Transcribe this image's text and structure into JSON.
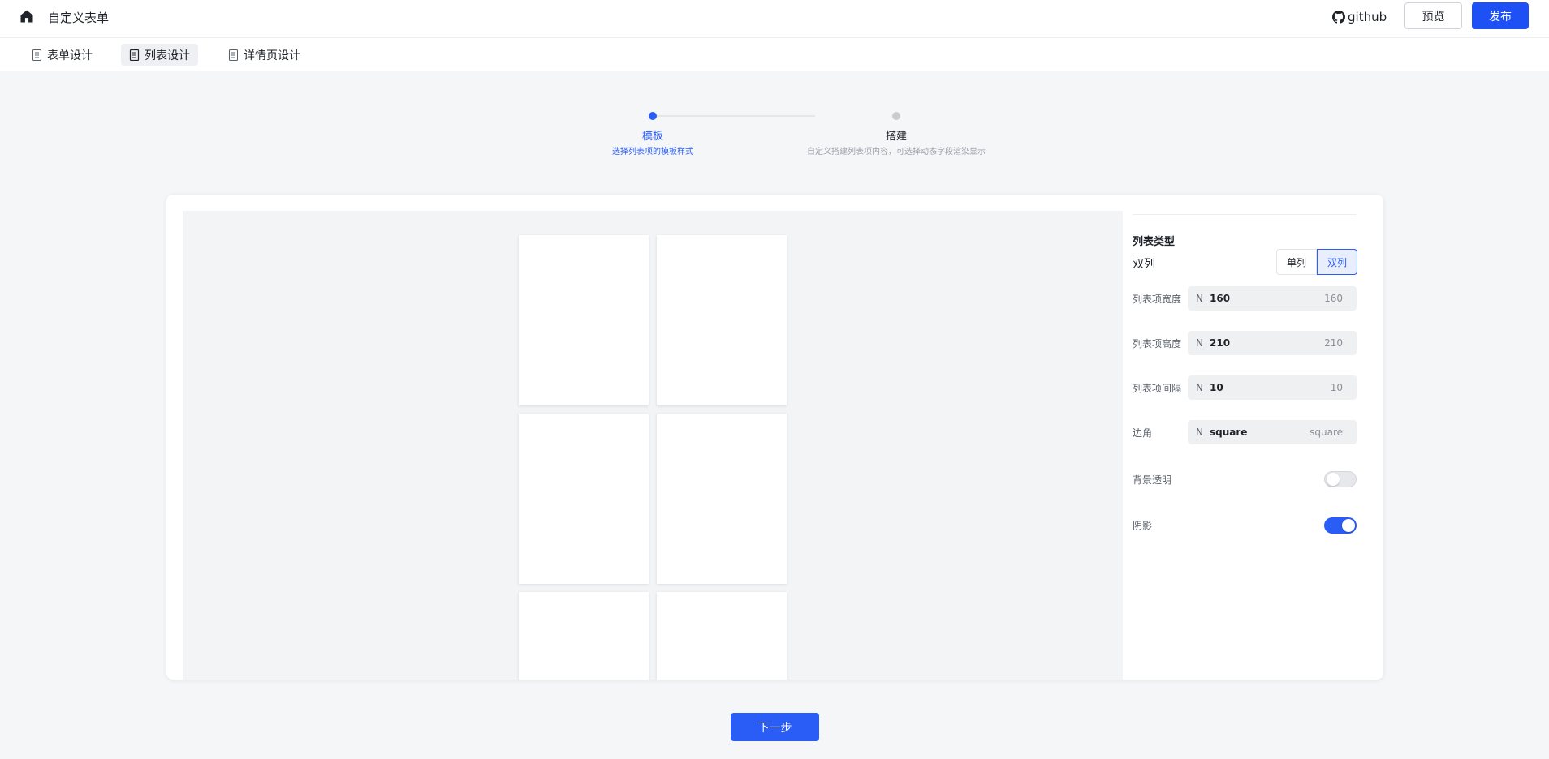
{
  "header": {
    "app_title": "自定义表单",
    "github_label": "github",
    "preview_label": "预览",
    "publish_label": "发布"
  },
  "tabs": [
    {
      "label": "表单设计",
      "active": false
    },
    {
      "label": "列表设计",
      "active": true
    },
    {
      "label": "详情页设计",
      "active": false
    }
  ],
  "steps": [
    {
      "title": "模板",
      "desc": "选择列表项的模板样式",
      "status": "current"
    },
    {
      "title": "搭建",
      "desc": "自定义搭建列表项内容，可选择动态字段渲染显示",
      "status": "wait"
    }
  ],
  "panel": {
    "section_title": "列表类型",
    "type_value": "双列",
    "options": [
      "单列",
      "双列"
    ],
    "selected_option": "双列",
    "width": {
      "label": "列表项宽度",
      "prefix": "N",
      "value": "160",
      "hint": "160"
    },
    "height": {
      "label": "列表项高度",
      "prefix": "N",
      "value": "210",
      "hint": "210"
    },
    "gap": {
      "label": "列表项间隔",
      "prefix": "N",
      "value": "10",
      "hint": "10"
    },
    "corner": {
      "label": "边角",
      "prefix": "N",
      "value": "square",
      "hint": "square"
    },
    "transparent": {
      "label": "背景透明",
      "on": false
    },
    "shadow": {
      "label": "阴影",
      "on": true
    }
  },
  "footer": {
    "next_label": "下一步"
  },
  "colors": {
    "primary": "#2a5cf6",
    "publish": "#1e51f5"
  }
}
